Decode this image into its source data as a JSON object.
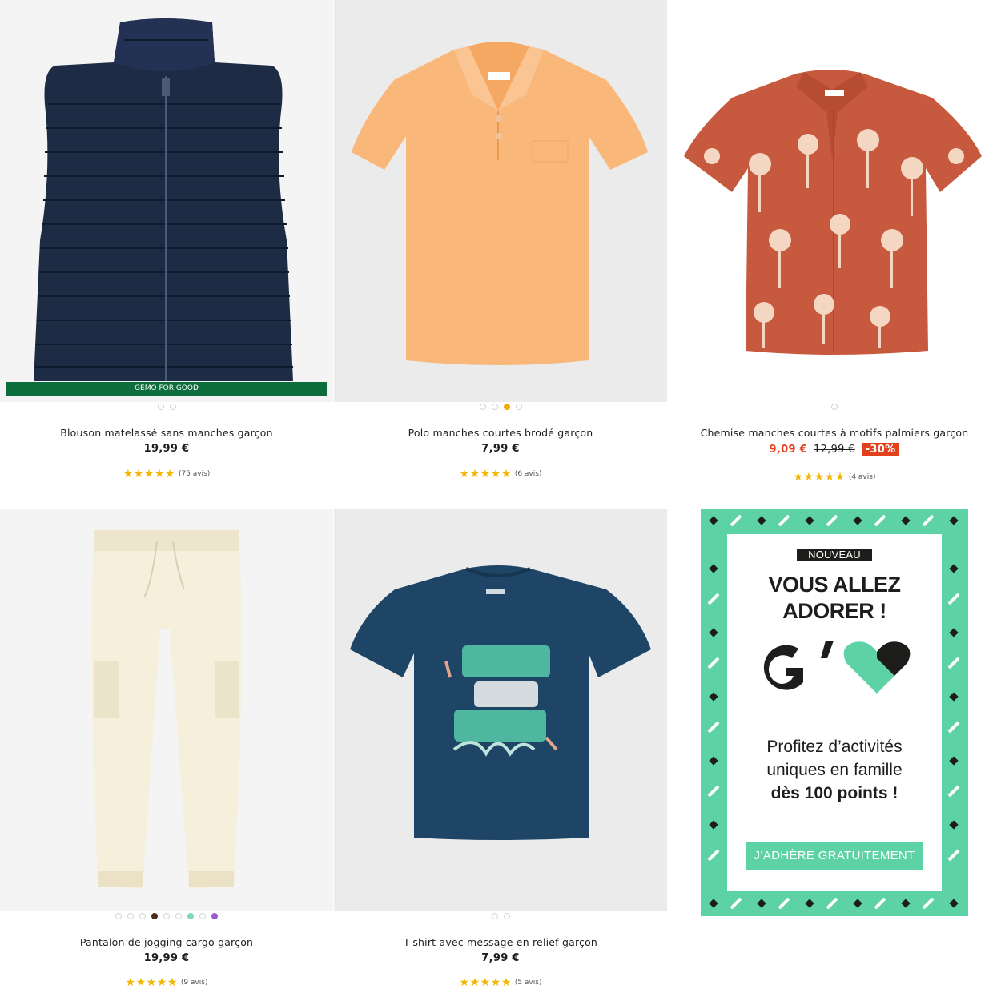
{
  "products": [
    {
      "name": "Blouson matelassé sans manches garçon",
      "price": "19,99 €",
      "stars": "★★★★★",
      "reviews": "(75 avis)",
      "badge": "GEMO FOR GOOD",
      "image_icon": "puffer-vest-image"
    },
    {
      "name": "Polo manches courtes brodé garçon",
      "price": "7,99 €",
      "stars": "★★★★★",
      "reviews": "(6 avis)",
      "image_icon": "polo-shirt-image"
    },
    {
      "name": "Chemise manches courtes à motifs palmiers garçon",
      "sale_price": "9,09 €",
      "old_price": "12,99 €",
      "discount": "-30%",
      "stars": "★★★★★",
      "reviews": "(4 avis)",
      "image_icon": "palm-shirt-image"
    },
    {
      "name": "Pantalon de jogging cargo garçon",
      "price": "19,99 €",
      "stars": "★★★★★",
      "reviews": "(9 avis)",
      "image_icon": "cargo-jogger-image"
    },
    {
      "name": "T-shirt avec message en relief garçon",
      "price": "7,99 €",
      "stars": "★★★★★",
      "reviews": "(5 avis)",
      "image_icon": "tshirt-image"
    }
  ],
  "promo": {
    "tag": "NOUVEAU",
    "headline_line1": "VOUS ALLEZ",
    "headline_line2": "ADORER !",
    "logo_icon": "g-heart-logo",
    "body_line1": "Profitez d’activités",
    "body_line2": "uniques en famille",
    "body_line3": "dès 100 points !",
    "cta": "J’ADHÈRE GRATUITEMENT"
  },
  "colors": {
    "accent_green": "#5dd3a5",
    "sale_red": "#e3411c",
    "star_yellow": "#f2b705",
    "good_green": "#0e6d3c",
    "active_dot": "#f2a900"
  },
  "ratings": [
    4.5,
    5,
    5,
    5,
    5
  ]
}
